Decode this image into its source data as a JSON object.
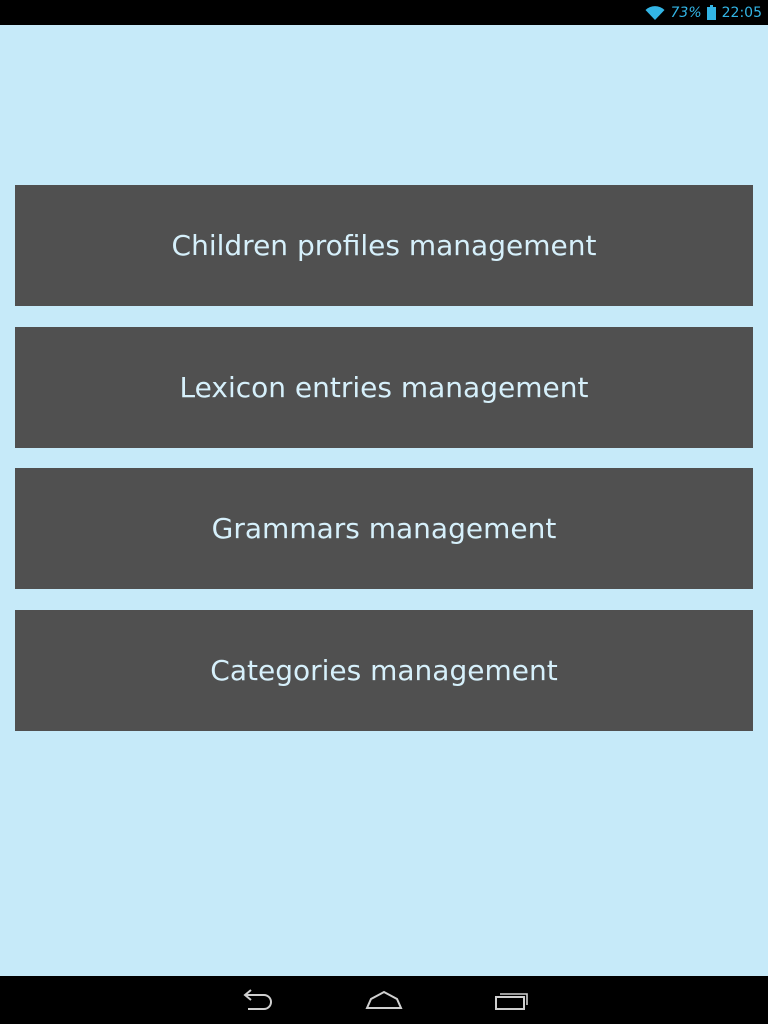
{
  "status_bar": {
    "battery_percent": "73%",
    "time": "22:05",
    "icons": [
      "wifi-icon",
      "battery-icon"
    ],
    "accent_color": "#33b5e5"
  },
  "menu": {
    "background_color": "#c6eaf9",
    "button_color": "#505050",
    "text_color": "#d6f0fb",
    "buttons": [
      {
        "label": "Children profiles management"
      },
      {
        "label": "Lexicon entries management"
      },
      {
        "label": "Grammars management"
      },
      {
        "label": "Categories management"
      }
    ]
  },
  "nav_bar": {
    "icons": [
      "back-icon",
      "home-icon",
      "recents-icon"
    ]
  }
}
